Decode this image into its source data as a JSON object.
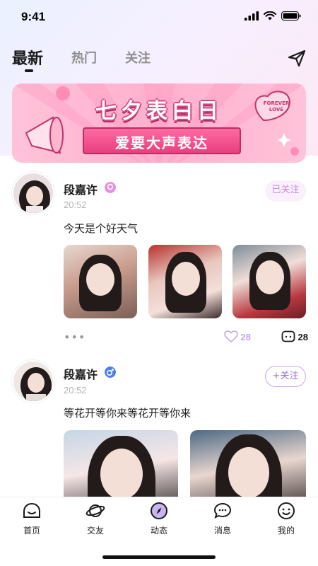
{
  "status_bar": {
    "time": "9:41"
  },
  "header": {
    "tabs": [
      {
        "label": "最新",
        "active": true
      },
      {
        "label": "热门",
        "active": false
      },
      {
        "label": "关注",
        "active": false
      }
    ],
    "send_icon": "paper-plane-icon"
  },
  "banner": {
    "title": "七夕表白日",
    "subtitle": "爱要大声表达",
    "badge": "FOREVER LOVE"
  },
  "posts": [
    {
      "username": "段嘉许",
      "gender": "female",
      "time": "20:52",
      "text": "今天是个好天气",
      "follow_label": "已关注",
      "likes": "28",
      "comments": "28"
    },
    {
      "username": "段嘉许",
      "gender": "male",
      "time": "20:52",
      "text": "等花开等你来等花开等你来",
      "follow_label": "+关注"
    }
  ],
  "tabbar": [
    {
      "label": "首页",
      "icon": "home-icon"
    },
    {
      "label": "交友",
      "icon": "planet-icon"
    },
    {
      "label": "动态",
      "icon": "compass-icon",
      "active": true
    },
    {
      "label": "消息",
      "icon": "message-icon"
    },
    {
      "label": "我的",
      "icon": "profile-icon"
    }
  ],
  "colors": {
    "accent": "#c68ad8",
    "like": "#c5a3ea",
    "female_badge": "#e98ee0",
    "male_badge": "#4b7cf0"
  }
}
